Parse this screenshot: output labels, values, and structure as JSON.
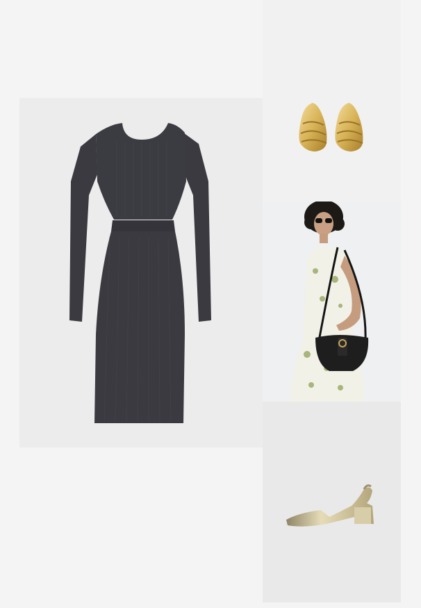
{
  "outfit": {
    "items": [
      {
        "item": "dress",
        "image": "black-ribbed-cutout-midi-dress-image",
        "color": "#3a3a40"
      },
      {
        "item": "earrings",
        "image": "gold-chunky-earrings-image",
        "color": "#d8b357"
      },
      {
        "item": "bag",
        "image": "model-with-black-saddle-bag-image",
        "color": "#1e1e1e"
      },
      {
        "item": "shoes",
        "image": "gold-slingback-block-heel-image",
        "color": "#c9b98a"
      }
    ]
  },
  "colors": {
    "page_background": "#f4f4f4",
    "dress": "#3a3a40",
    "gold": "#d8b357",
    "bag": "#1e1e1e"
  }
}
